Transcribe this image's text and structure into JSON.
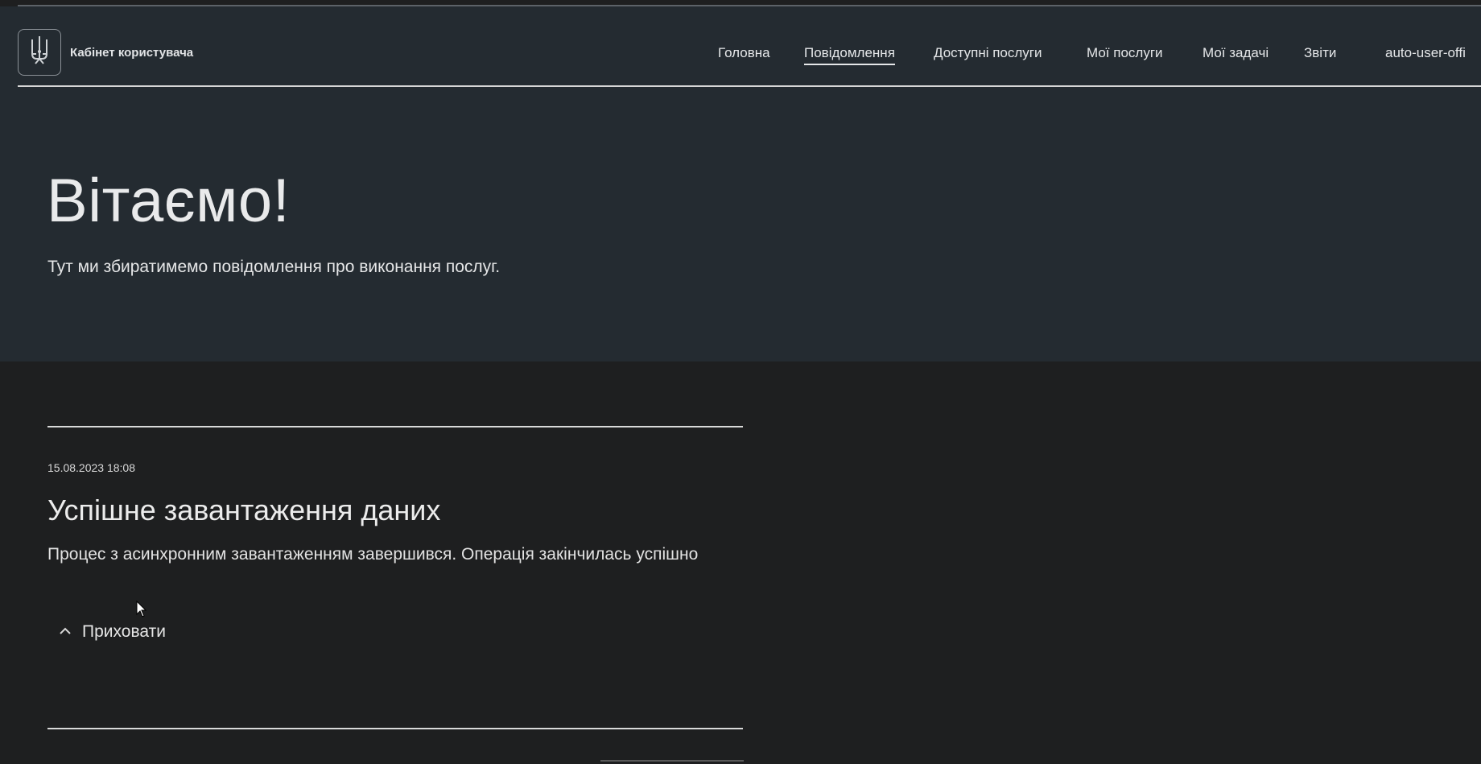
{
  "header": {
    "brand": "Кабінет користувача",
    "nav": [
      {
        "label": "Головна"
      },
      {
        "label": "Повідомлення",
        "active": true
      },
      {
        "label": "Доступні послуги"
      },
      {
        "label": "Мої послуги"
      },
      {
        "label": "Мої задачі"
      },
      {
        "label": "Звіти"
      },
      {
        "label": "auto-user-offi"
      }
    ]
  },
  "hero": {
    "title": "Вітаємо!",
    "subtitle": "Тут ми збиратимемо повідомлення про виконання послуг."
  },
  "message": {
    "date": "15.08.2023 18:08",
    "title": "Успішне завантаження даних",
    "body": "Процес з асинхронним завантаженням завершився. Операція закінчилась успішно",
    "toggle_label": "Приховати"
  },
  "icons": {
    "logo": "trident-icon",
    "toggle": "chevron-up-icon",
    "cursor": "mouse-pointer-icon"
  },
  "colors": {
    "header_bg": "#242b31",
    "page_bg": "#1e1f20",
    "text": "#e6e6e6"
  }
}
